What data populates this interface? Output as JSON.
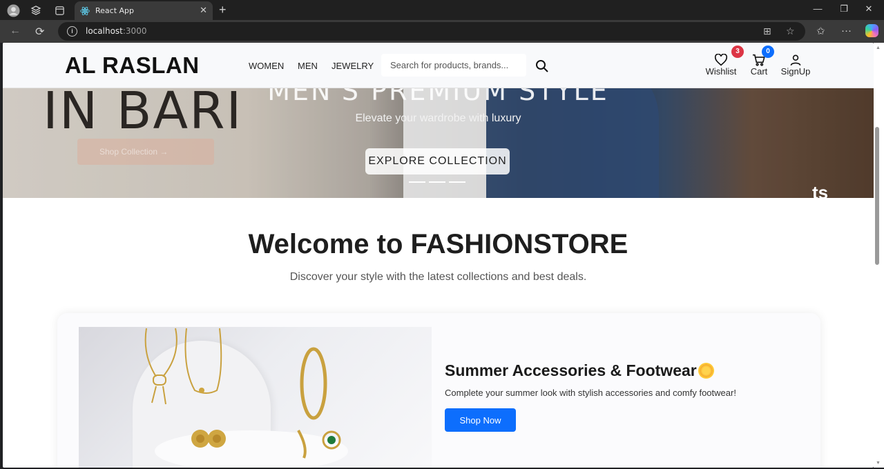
{
  "browser": {
    "tab_title": "React App",
    "url_host": "localhost",
    "url_port": ":3000"
  },
  "hero": {
    "background_text": "IN BARI",
    "heading": "MEN'S PREMIUM STYLE",
    "subheading": "Elevate your wardrobe with luxury",
    "cta_label": "EXPLORE COLLECTION",
    "corner_mark": "ts",
    "slide_count": 3
  },
  "navbar": {
    "brand": "AL RASLAN",
    "menu": [
      "WOMEN",
      "MEN",
      "JEWELRY"
    ],
    "search_placeholder": "Search for products, brands...",
    "wishlist": {
      "label": "Wishlist",
      "count": "3"
    },
    "cart": {
      "label": "Cart",
      "count": "0"
    },
    "signup": {
      "label": "SignUp"
    }
  },
  "main": {
    "welcome_title": "Welcome to FASHIONSTORE",
    "tagline": "Discover your style with the latest collections and best deals.",
    "promo": {
      "title": "Summer Accessories & Footwear",
      "description": "Complete your summer look with stylish accessories and comfy footwear!",
      "button_label": "Shop Now"
    }
  },
  "colors": {
    "accent": "#0d6efd",
    "wishlist_badge": "#dc3545",
    "cart_badge": "#0d6efd"
  }
}
